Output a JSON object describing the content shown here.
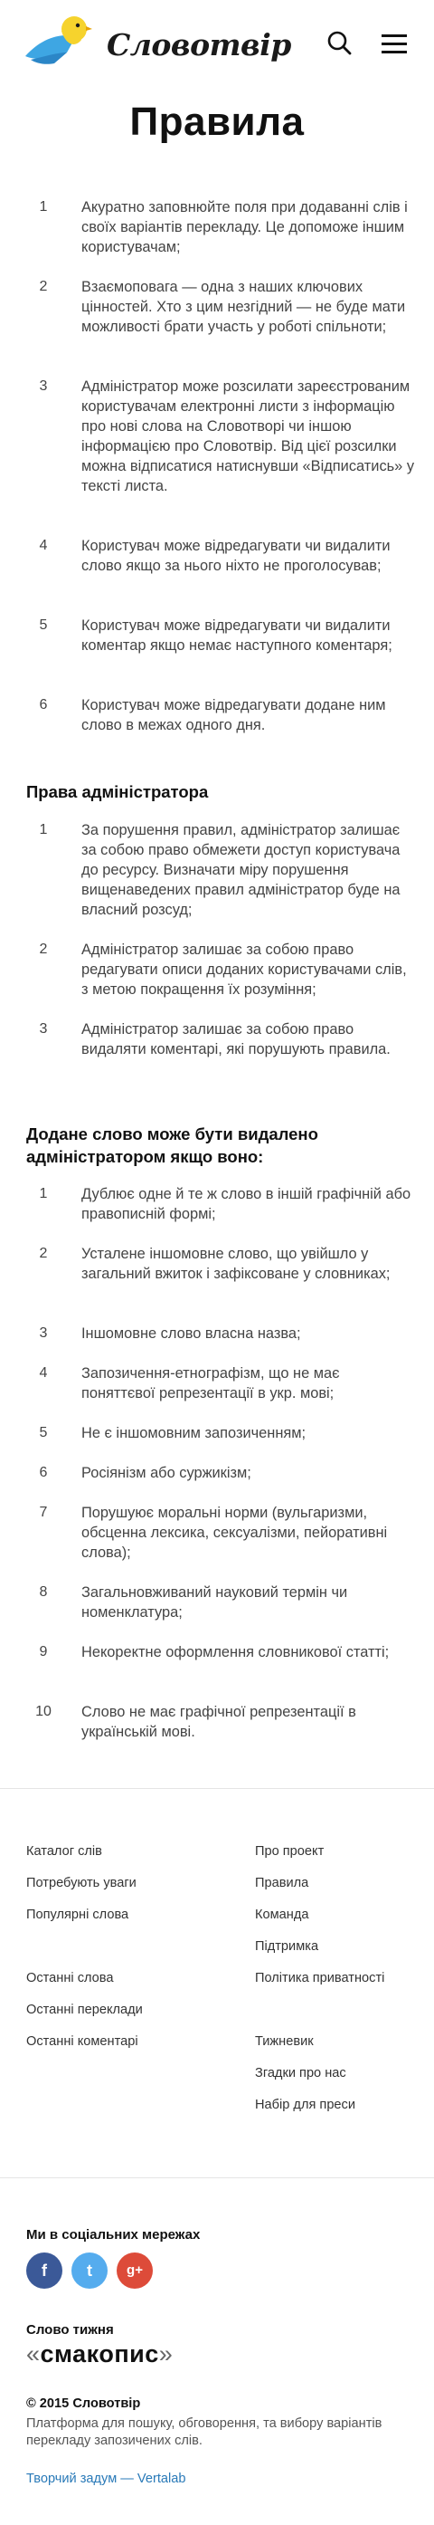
{
  "header": {
    "logo_text": "Словотвір"
  },
  "page_title": "Правила",
  "rules": [
    {
      "num": "1",
      "text": "Акуратно заповнюйте поля при додаванні слів і своїх варіантів перекладу. Це допоможе іншим користувачам;"
    },
    {
      "num": "2",
      "text": "Взаємоповага — одна з наших ключових цінностей. Хто з цим незгідний — не буде мати можливості брати участь у роботі спільноти;"
    },
    {
      "num": "3",
      "text": "Адміністратор може розсилати зареєстрованим користувачам електронні листи з інформацію про нові слова на Словотворі чи іншою інформацією про Словотвір. Від цієї розсилки можна відписатися натиснувши «Відписатись» у тексті листа."
    },
    {
      "num": "4",
      "text": "Користувач може відредагувати чи видалити слово якщо за нього ніхто не проголосував;"
    },
    {
      "num": "5",
      "text": "Користувач може відредагувати чи видалити коментар якщо немає наступного коментаря;"
    },
    {
      "num": "6",
      "text": "Користувач може відредагувати додане ним слово в межах одного дня."
    }
  ],
  "admin_title": "Права адміністратора",
  "admin_rules": [
    {
      "num": "1",
      "text": "За порушення правил, адміністратор залишає за собою право обмежети доступ користувача до ресурсу. Визначати міру порушення вищенаведених правил адміністратор буде на власний розсуд;"
    },
    {
      "num": "2",
      "text": "Адміністратор залишає за собою право редагувати описи доданих користувачами слів, з метою покращення їх розуміння;"
    },
    {
      "num": "3",
      "text": "Адміністратор залишає за собою право видаляти коментарі, які порушують правила."
    }
  ],
  "removal_title": "Додане слово може бути видалено адміністратором якщо воно:",
  "removal_rules": [
    {
      "num": "1",
      "text": "Дублює одне й те ж слово в іншій графічній або правописній формі;"
    },
    {
      "num": "2",
      "text": "Усталене іншомовне слово, що увійшло у загальний вжиток і зафіксоване у словниках;"
    },
    {
      "num": "3",
      "text": "Іншомовне слово власна назва;"
    },
    {
      "num": "4",
      "text": "Запозичення-етнографізм, що не має поняттєвої репрезентації в укр. мові;"
    },
    {
      "num": "5",
      "text": "Не є іншомовним запозиченням;"
    },
    {
      "num": "6",
      "text": "Росіянізм або суржикізм;"
    },
    {
      "num": "7",
      "text": "Порушуює моральні норми (вульгаризми, обсценна лексика, сексуалізми, пейоративні слова);"
    },
    {
      "num": "8",
      "text": "Загальновживаний науковий термін чи номенклатура;"
    },
    {
      "num": "9",
      "text": "Некоректне оформлення словникової статті;"
    },
    {
      "num": "10",
      "text": "Слово не має графічної репрезентації в українській мові."
    }
  ],
  "footer": {
    "col1": [
      "Каталог слів",
      "Потребують уваги",
      "Популярні слова",
      "Останні слова",
      "Останні переклади",
      "Останні коментарі"
    ],
    "col2": [
      "Про проект",
      "Правила",
      "Команда",
      "Підтримка",
      "Політика приватності",
      "Тижневик",
      "Згадки про нас",
      "Набір для преси"
    ],
    "social_title": "Ми в соціальних мережах",
    "social": {
      "facebook": "f",
      "twitter": "t",
      "google": "g+"
    },
    "word_title": "Слово тижня",
    "word_open": "«",
    "word": "смакопис",
    "word_close": "»",
    "copyright": "© 2015 Словотвір",
    "tagline": "Платформа для пошуку, обговорення, та вибору варіантів перекладу запозичених слів.",
    "credit": "Творчий задум — Vertalab"
  },
  "colors": {
    "accent_blue": "#2a7ab8",
    "logo_yellow": "#f6d32d",
    "logo_blue": "#3ea6e3",
    "facebook": "#3b5998",
    "twitter": "#55acee",
    "google": "#dd4b39"
  }
}
